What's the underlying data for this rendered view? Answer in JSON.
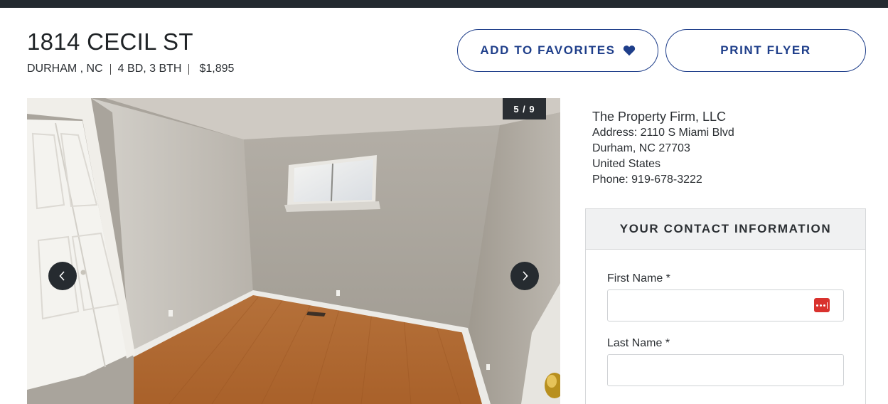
{
  "listing": {
    "address": "1814 CECIL ST",
    "city_state": "DURHAM , NC",
    "beds_baths": "4 BD, 3 BTH",
    "price": "$1,895"
  },
  "actions": {
    "favorites_label": "ADD TO FAVORITES",
    "print_label": "PRINT FLYER"
  },
  "gallery": {
    "counter": "5 / 9",
    "prev_icon": "chevron-left-icon",
    "next_icon": "chevron-right-icon"
  },
  "agent": {
    "firm": "The Property Firm, LLC",
    "address_line": "Address: 2110 S Miami Blvd",
    "city_line": "Durham, NC 27703",
    "country": "United States",
    "phone_line": "Phone: 919-678-3222"
  },
  "contact_form": {
    "heading": "YOUR CONTACT INFORMATION",
    "first_name_label": "First Name *",
    "first_name_value": "",
    "last_name_label": "Last Name *",
    "last_name_value": ""
  },
  "colors": {
    "accent": "#1e3e8a",
    "topbar": "#232a30",
    "password_manager_icon": "#d9322e"
  }
}
